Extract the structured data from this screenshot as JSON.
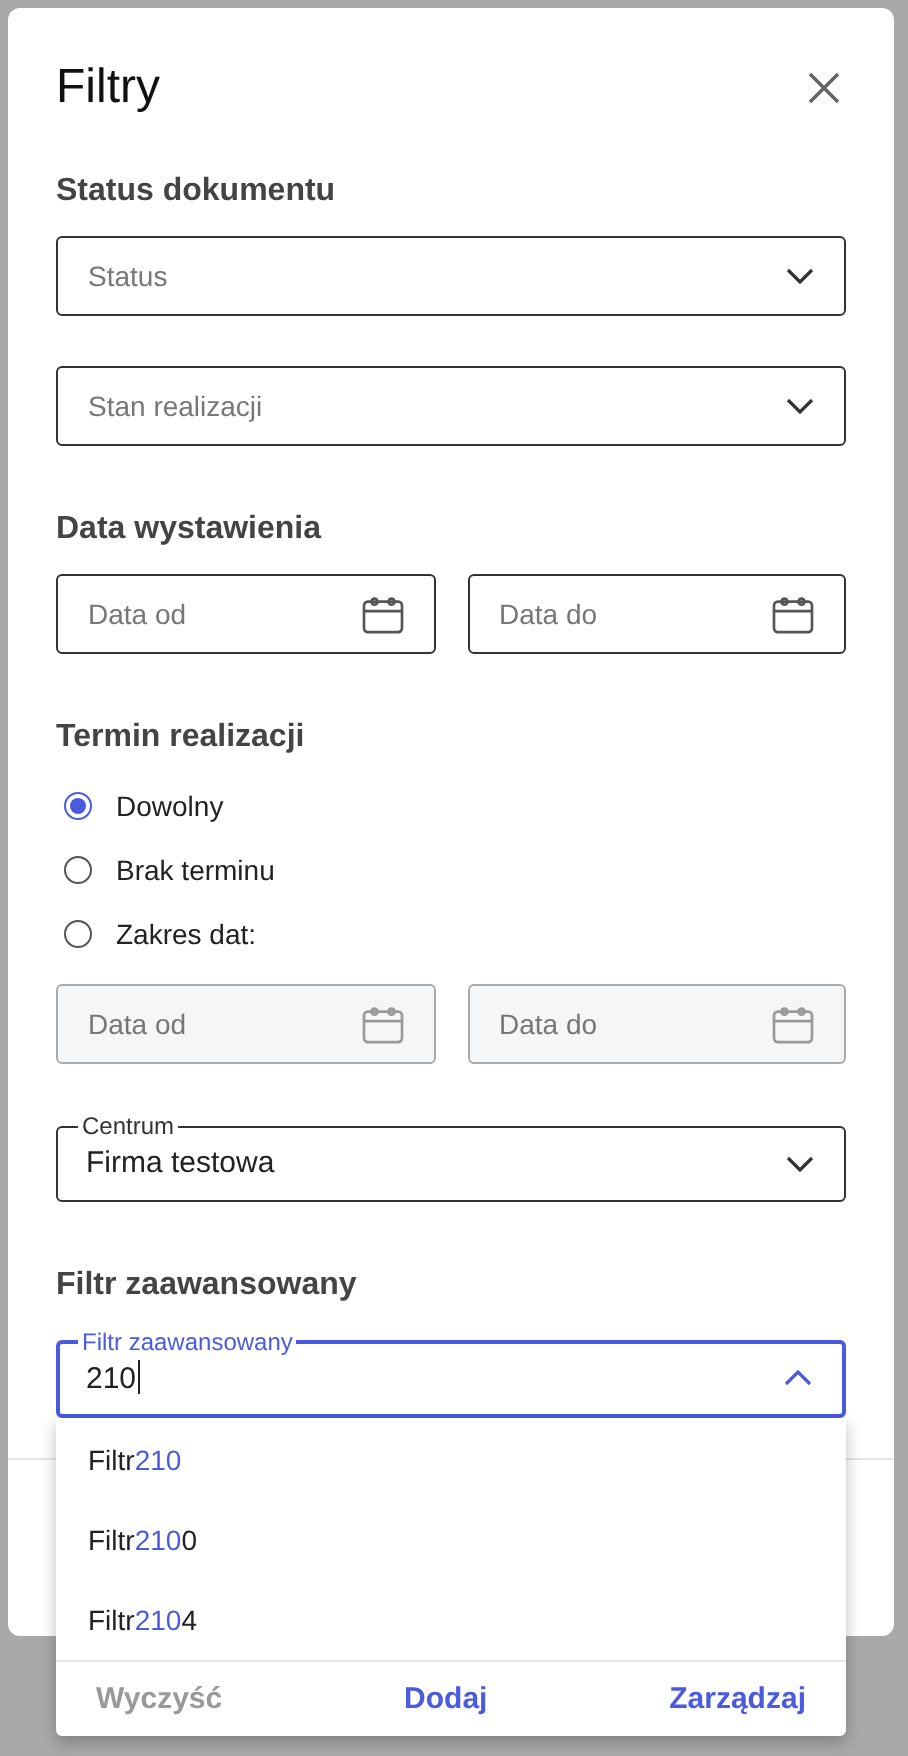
{
  "dialog": {
    "title": "Filtry",
    "sections": [
      {
        "heading": "Status dokumentu",
        "fields": [
          {
            "kind": "select",
            "placeholder": "Status"
          },
          {
            "kind": "select",
            "placeholder": "Stan realizacji"
          }
        ]
      },
      {
        "heading": "Data wystawienia",
        "fields": [
          {
            "kind": "date",
            "placeholder": "Data od",
            "disabled": false
          },
          {
            "kind": "date",
            "placeholder": "Data do",
            "disabled": false
          }
        ]
      },
      {
        "heading": "Termin realizacji",
        "radios": [
          {
            "label": "Dowolny",
            "selected": true
          },
          {
            "label": "Brak terminu",
            "selected": false
          },
          {
            "label": "Zakres dat:",
            "selected": false
          }
        ],
        "fields": [
          {
            "kind": "date",
            "placeholder": "Data od",
            "disabled": true
          },
          {
            "kind": "date",
            "placeholder": "Data do",
            "disabled": true
          }
        ]
      },
      {
        "fields": [
          {
            "kind": "outlined_select",
            "label": "Centrum",
            "value": "Firma testowa"
          }
        ]
      },
      {
        "heading": "Filtr zaawansowany",
        "fields": [
          {
            "kind": "autocomplete",
            "label": "Filtr zaawansowany",
            "value": "210",
            "expanded": true,
            "options": [
              {
                "parts": [
                  {
                    "text": "Filtr",
                    "match": false
                  },
                  {
                    "text": "210",
                    "match": true
                  }
                ]
              },
              {
                "parts": [
                  {
                    "text": "Filtr",
                    "match": false
                  },
                  {
                    "text": "210",
                    "match": true
                  },
                  {
                    "text": "0",
                    "match": false
                  }
                ]
              },
              {
                "parts": [
                  {
                    "text": "Filtr",
                    "match": false
                  },
                  {
                    "text": "210",
                    "match": true
                  },
                  {
                    "text": "4",
                    "match": false
                  }
                ]
              }
            ],
            "actions": [
              {
                "label": "Wyczyść",
                "disabled": true
              },
              {
                "label": "Dodaj",
                "disabled": false
              },
              {
                "label": "Zarządzaj",
                "disabled": false
              }
            ]
          }
        ]
      }
    ]
  }
}
